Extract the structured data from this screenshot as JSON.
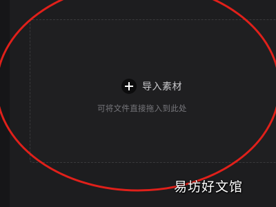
{
  "import": {
    "label": "导入素材",
    "icon": "plus-icon"
  },
  "hint": "可将文件直接拖入到此处",
  "annotation": {
    "color": "#e0201a",
    "shape": "ellipse"
  },
  "watermark": "易坊好文馆"
}
